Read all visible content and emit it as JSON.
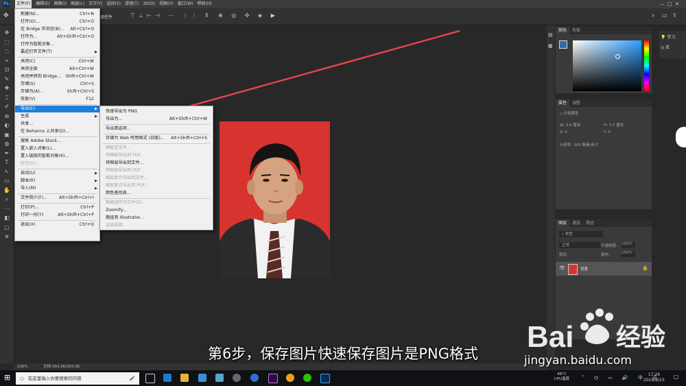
{
  "app": {
    "logo": "Ps",
    "menubar": [
      "文件(F)",
      "编辑(E)",
      "图像(I)",
      "图层(L)",
      "文字(Y)",
      "选择(S)",
      "滤镜(T)",
      "3D(D)",
      "视图(V)",
      "窗口(W)",
      "帮助(H)"
    ],
    "options_fragment": "换控件",
    "right_top": {
      "learn": "学习",
      "library": "库"
    }
  },
  "file_menu": [
    {
      "label": "新建(N)...",
      "shortcut": "Ctrl+N"
    },
    {
      "label": "打开(O)...",
      "shortcut": "Ctrl+O"
    },
    {
      "label": "在 Bridge 中浏览(B)...",
      "shortcut": "Alt+Ctrl+O"
    },
    {
      "label": "打开为...",
      "shortcut": "Alt+Shift+Ctrl+O"
    },
    {
      "label": "打开为智能对象...",
      "shortcut": ""
    },
    {
      "label": "最近打开文件(T)",
      "shortcut": "",
      "submenu": true
    },
    {
      "sep": true
    },
    {
      "label": "关闭(C)",
      "shortcut": "Ctrl+W"
    },
    {
      "label": "关闭全部",
      "shortcut": "Alt+Ctrl+W"
    },
    {
      "label": "关闭并转到 Bridge...",
      "shortcut": "Shift+Ctrl+W"
    },
    {
      "label": "存储(S)",
      "shortcut": "Ctrl+S"
    },
    {
      "label": "存储为(A)...",
      "shortcut": "Shift+Ctrl+S"
    },
    {
      "label": "恢复(V)",
      "shortcut": "F12"
    },
    {
      "sep": true
    },
    {
      "label": "导出(E)",
      "shortcut": "",
      "submenu": true,
      "highlight": true
    },
    {
      "label": "生成",
      "shortcut": "",
      "submenu": true
    },
    {
      "label": "共享...",
      "shortcut": ""
    },
    {
      "label": "在 Behance 上共享(D)...",
      "shortcut": ""
    },
    {
      "sep": true
    },
    {
      "label": "搜索 Adobe Stock...",
      "shortcut": ""
    },
    {
      "label": "置入嵌入对象(L)...",
      "shortcut": ""
    },
    {
      "label": "置入链接的智能对象(K)...",
      "shortcut": ""
    },
    {
      "label": "打包(G)...",
      "shortcut": "",
      "disabled": true
    },
    {
      "sep": true
    },
    {
      "label": "自动(U)",
      "shortcut": "",
      "submenu": true
    },
    {
      "label": "脚本(R)",
      "shortcut": "",
      "submenu": true
    },
    {
      "label": "导入(M)",
      "shortcut": "",
      "submenu": true
    },
    {
      "sep": true
    },
    {
      "label": "文件简介(F)...",
      "shortcut": "Alt+Shift+Ctrl+I"
    },
    {
      "sep": true
    },
    {
      "label": "打印(P)...",
      "shortcut": "Ctrl+P"
    },
    {
      "label": "打印一份(Y)",
      "shortcut": "Alt+Shift+Ctrl+P"
    },
    {
      "sep": true
    },
    {
      "label": "退出(X)",
      "shortcut": "Ctrl+Q"
    }
  ],
  "export_menu": [
    {
      "label": "快速导出为 PNG",
      "shortcut": ""
    },
    {
      "label": "导出为...",
      "shortcut": "Alt+Shift+Ctrl+W"
    },
    {
      "sep": true
    },
    {
      "label": "导出首选项...",
      "shortcut": ""
    },
    {
      "sep": true
    },
    {
      "label": "存储为 Web 所用格式 (旧版)...",
      "shortcut": "Alt+Shift+Ctrl+S"
    },
    {
      "sep": true
    },
    {
      "label": "画板至文件...",
      "shortcut": "",
      "disabled": true
    },
    {
      "label": "将画板导出到 PDF...",
      "shortcut": "",
      "disabled": true
    },
    {
      "label": "将图层导出到文件...",
      "shortcut": ""
    },
    {
      "label": "将图层导出到 PDF...",
      "shortcut": "",
      "disabled": true
    },
    {
      "label": "图层复合导出到文件...",
      "shortcut": "",
      "disabled": true
    },
    {
      "label": "图层复合导出到 PDF...",
      "shortcut": "",
      "disabled": true
    },
    {
      "label": "颜色查找表...",
      "shortcut": ""
    },
    {
      "sep": true
    },
    {
      "label": "数据组作为文件(D)...",
      "shortcut": "",
      "disabled": true
    },
    {
      "label": "Zoomify...",
      "shortcut": ""
    },
    {
      "label": "路径到 Illustrator...",
      "shortcut": ""
    },
    {
      "label": "渲染视频...",
      "shortcut": "",
      "disabled": true
    }
  ],
  "panels": {
    "color": {
      "tabs": [
        "颜色",
        "色板"
      ]
    },
    "properties": {
      "tabs": [
        "属性",
        "调整"
      ],
      "title": "文档属性",
      "w_label": "W:",
      "w_value": "2.6 厘米",
      "h_label": "H:",
      "h_value": "3.7 厘米",
      "x_label": "X:",
      "x_value": "0",
      "y_label": "Y:",
      "y_value": "0",
      "resolution": "分辨率: 300 像素/英寸"
    },
    "layers": {
      "tabs": [
        "图层",
        "通道",
        "路径"
      ],
      "filter": "类型",
      "blend_mode": "正常",
      "opacity_label": "不透明度:",
      "opacity_value": "100%",
      "lock_label": "锁定:",
      "fill_label": "填充:",
      "fill_value": "100%",
      "layer_name": "背景"
    }
  },
  "statusbar": {
    "zoom": "100%",
    "doc": "文档:393.0K/393.0K"
  },
  "caption": "第6步，保存图片快速保存图片是PNG格式",
  "watermark": {
    "url": "jingyan.baidu.com"
  },
  "taskbar": {
    "search_placeholder": "在这里输入你要搜索的内容",
    "temp": "48°C",
    "temp_label": "CPU温度",
    "time": "17:26",
    "date": "2019/8/15"
  },
  "colors": {
    "menu_highlight": "#1f7fd8",
    "photo_bg": "#d7332f",
    "arrow": "#e0464a",
    "ps_blue": "#31a8ff"
  }
}
